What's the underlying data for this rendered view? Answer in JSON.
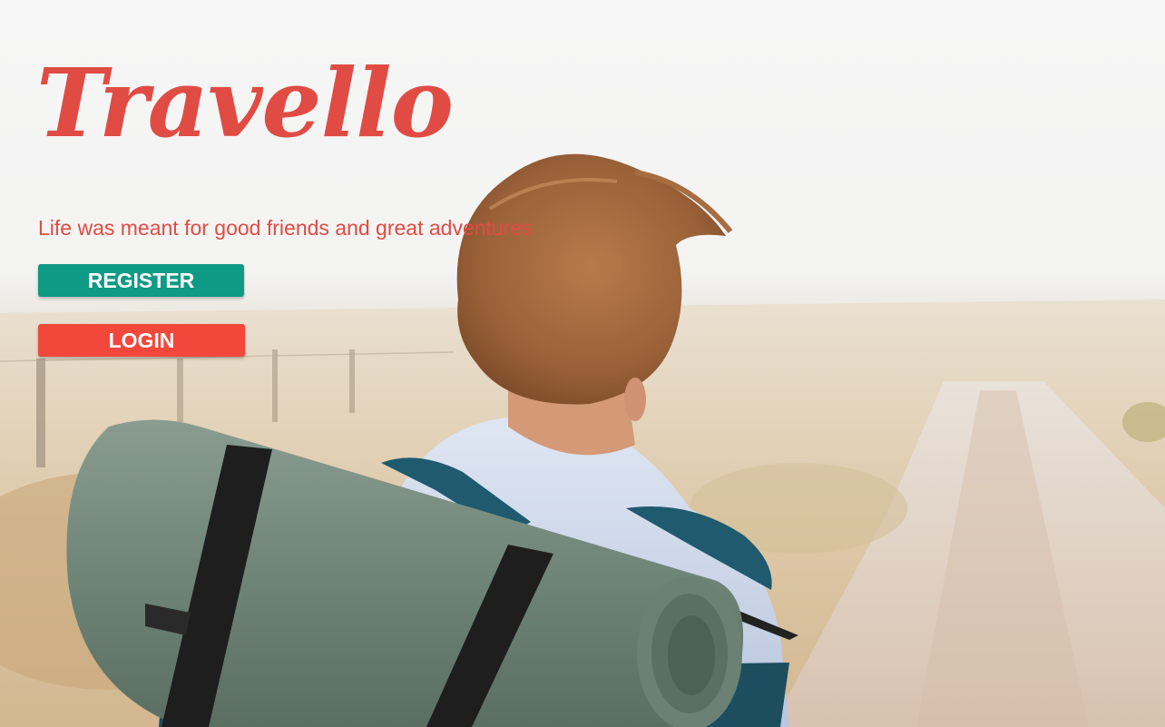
{
  "brand": {
    "name": "Travello",
    "color": "#e04c44"
  },
  "hero": {
    "tagline": "Life was meant for good friends and great adventures",
    "tagline_color": "#e04c44",
    "image": "backpacker-with-bedroll-on-dirt-road"
  },
  "actions": {
    "register_label": "REGISTER",
    "register_color": "#0f9a85",
    "login_label": "LOGIN",
    "login_color": "#f2473b"
  }
}
